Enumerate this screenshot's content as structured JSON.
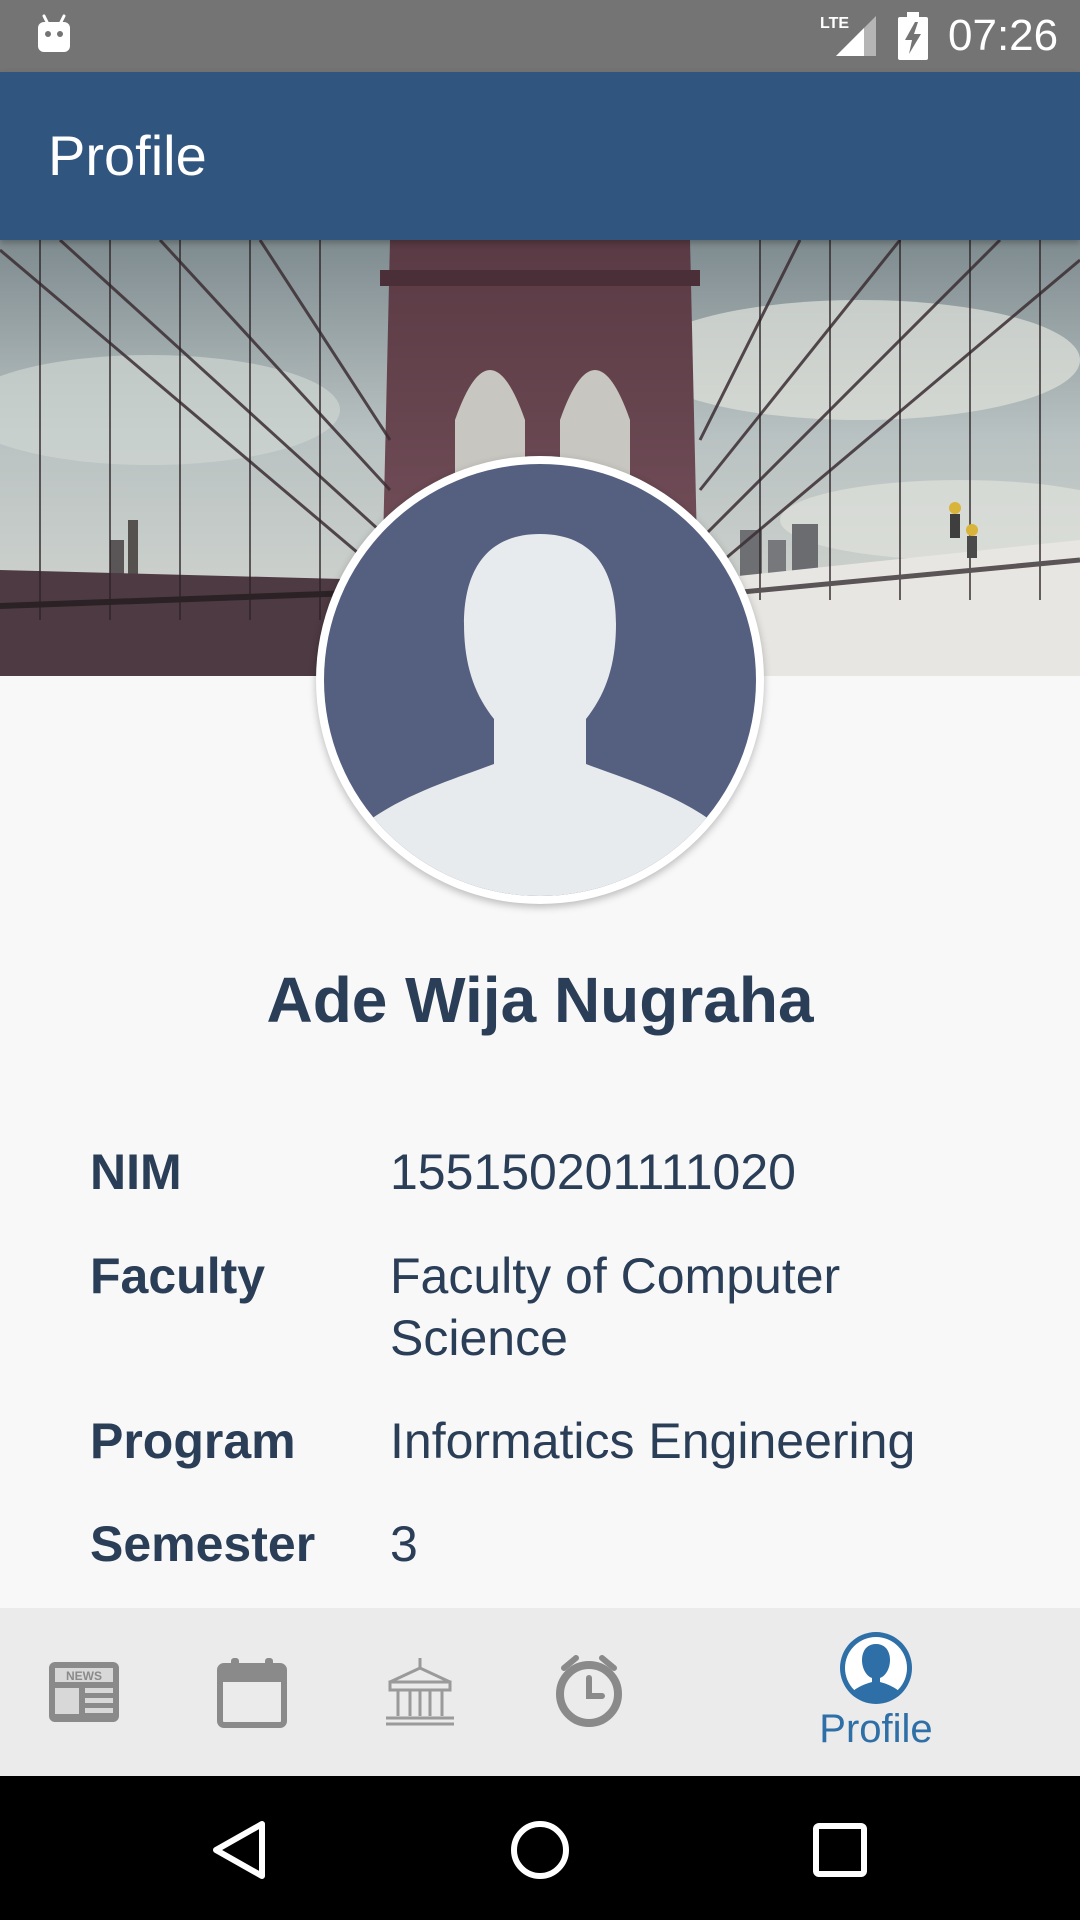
{
  "status_bar": {
    "time": "07:26",
    "network_label": "LTE",
    "icons": [
      "android-icon",
      "lte-signal-icon",
      "battery-charging-icon"
    ]
  },
  "app_bar": {
    "title": "Profile"
  },
  "profile": {
    "name": "Ade Wija Nugraha",
    "fields": [
      {
        "label": "NIM",
        "value": "155150201111020"
      },
      {
        "label": "Faculty",
        "value": "Faculty of Computer Science"
      },
      {
        "label": "Program",
        "value": "Informatics Engineering"
      },
      {
        "label": "Semester",
        "value": "3"
      }
    ]
  },
  "bottom_nav": {
    "items": [
      {
        "icon": "news-icon",
        "active": false
      },
      {
        "icon": "calendar-icon",
        "active": false
      },
      {
        "icon": "building-icon",
        "active": false
      },
      {
        "icon": "clock-icon",
        "active": false
      },
      {
        "icon": "profile-icon",
        "label": "Profile",
        "active": true
      }
    ],
    "active_color": "#2d6fa6",
    "inactive_color": "#8a8a8a"
  },
  "system_nav": {
    "buttons": [
      "back-icon",
      "home-icon",
      "recents-icon"
    ]
  },
  "colors": {
    "app_bar": "#30567f",
    "status_bar": "#747474",
    "text_primary": "#2b3e57",
    "background": "#f8f8f8"
  }
}
